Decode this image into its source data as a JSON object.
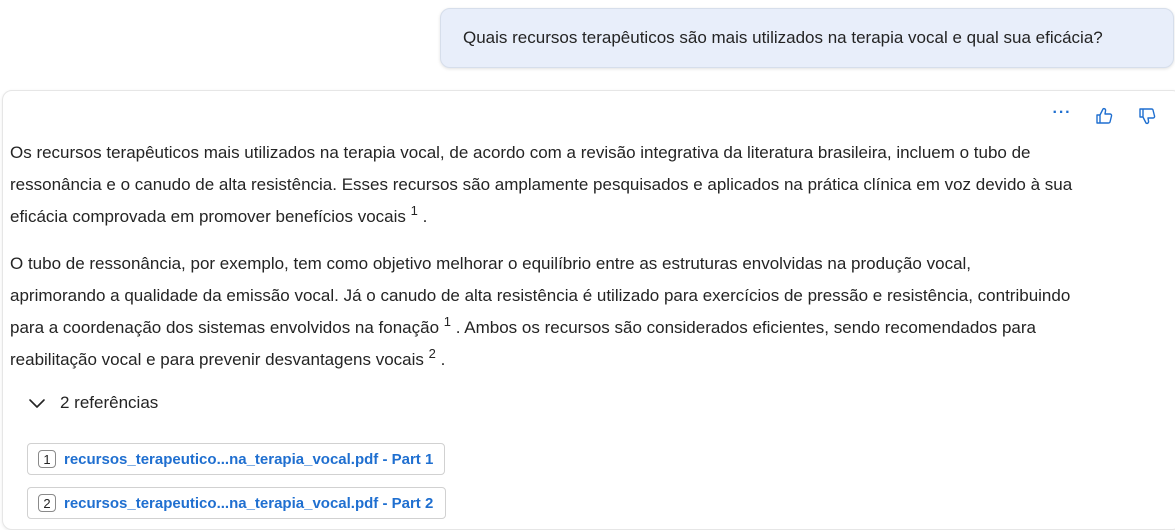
{
  "user_message": {
    "text": "Quais recursos terapêuticos são mais utilizados na terapia vocal e qual sua eficácia?"
  },
  "response": {
    "actions": {
      "more_label": "···",
      "like_icon": "thumbs-up-icon",
      "dislike_icon": "thumbs-down-icon",
      "accent_color": "#1f6fd0"
    },
    "paragraph1": {
      "line1": "Os recursos terapêuticos mais utilizados na terapia vocal, de acordo com a revisão integrativa da literatura brasileira, incluem o tubo de",
      "line2": "ressonância e o canudo de alta resistência. Esses recursos são amplamente pesquisados e aplicados na prática clínica em voz devido à sua",
      "line3": "eficácia comprovada em promover benefícios vocais",
      "cite": "1",
      "end": "."
    },
    "paragraph2": {
      "line1": "O tubo de ressonância, por exemplo, tem como objetivo melhorar o equilíbrio entre as estruturas envolvidas na produção vocal,",
      "line2": "aprimorando a qualidade da emissão vocal. Já o canudo de alta resistência é utilizado para exercícios de pressão e resistência, contribuindo",
      "line3a": "para a coordenação dos sistemas envolvidos na fonação",
      "cite1": "1",
      "line3b": ". Ambos os recursos são considerados eficientes, sendo recomendados para",
      "line4": "reabilitação vocal e para prevenir desvantagens vocais",
      "cite2": "2",
      "end": "."
    },
    "references": {
      "toggle_label": "2 referências",
      "toggle_icon": "chevron-down-icon",
      "items": [
        {
          "num": "1",
          "label": "recursos_terapeutico...na_terapia_vocal.pdf - Part 1"
        },
        {
          "num": "2",
          "label": "recursos_terapeutico...na_terapia_vocal.pdf - Part 2"
        }
      ]
    }
  }
}
